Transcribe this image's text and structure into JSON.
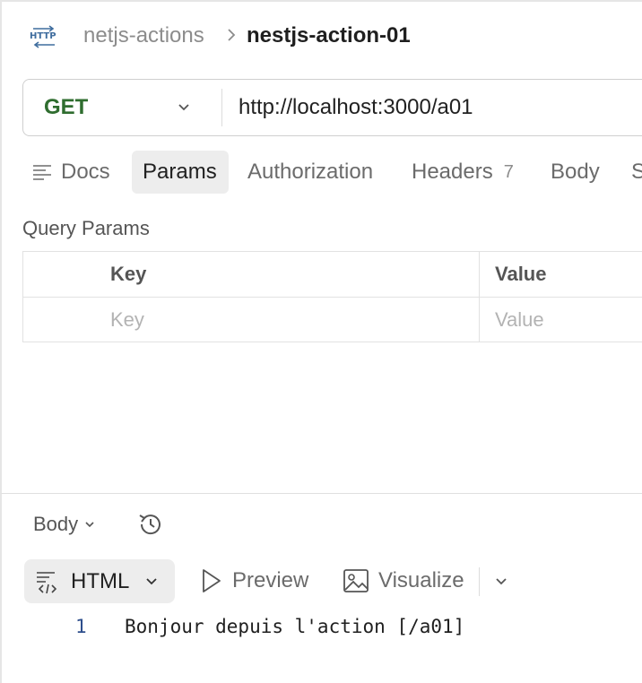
{
  "header": {
    "badge": "HTTP",
    "collection": "netjs-actions",
    "request_name": "nestjs-action-01"
  },
  "request": {
    "method": "GET",
    "url": "http://localhost:3000/a01"
  },
  "tabs": [
    {
      "label": "Docs"
    },
    {
      "label": "Params",
      "active": true
    },
    {
      "label": "Authorization"
    },
    {
      "label": "Headers",
      "count": "7"
    },
    {
      "label": "Body"
    },
    {
      "label": "S"
    }
  ],
  "query_params": {
    "title": "Query Params",
    "headers": {
      "key": "Key",
      "value": "Value"
    },
    "placeholder_key": "Key",
    "placeholder_value": "Value"
  },
  "response": {
    "section_label": "Body",
    "format": "HTML",
    "preview_label": "Preview",
    "visualize_label": "Visualize",
    "lines": [
      {
        "number": "1",
        "text": "Bonjour depuis l'action [/a01]"
      }
    ]
  },
  "colors": {
    "method_get": "#2f6d2f",
    "active_tab_bg": "#ededed",
    "badge": "#3f6d9e"
  }
}
